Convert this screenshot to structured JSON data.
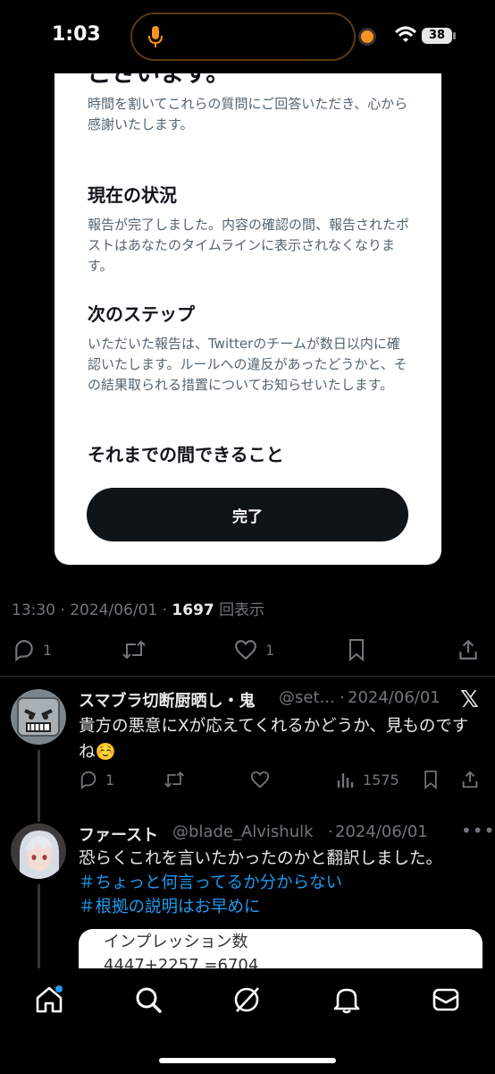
{
  "status": {
    "time": "1:03",
    "battery": "38"
  },
  "card": {
    "cut_heading": "ございます。",
    "intro": "時間を割いてこれらの質問にご回答いただき、心から感謝いたします。",
    "section1_title": "現在の状況",
    "section1_body": "報告が完了しました。内容の確認の間、報告されたポストはあなたのタイムラインに表示されなくなります。",
    "section2_title": "次のステップ",
    "section2_body": "いただいた報告は、Twitterのチームが数日以内に確認いたします。ルールへの違反があったどうかと、その結果取られる措置についてお知らせいたします。",
    "section3_title": "それまでの間できること",
    "done_label": "完了"
  },
  "post": {
    "time": "13:30",
    "date": "2024/06/01",
    "views": "1697",
    "views_label": "回表示",
    "replies": "1",
    "likes": "1"
  },
  "reply1": {
    "name": "スマブラ切断厨晒し・鬼",
    "handle": "@set...",
    "date": "2024/06/01",
    "text": "貴方の悪意にXが応えてくれるかどうか、見ものですね☺️",
    "replies": "1",
    "views": "1575"
  },
  "reply2": {
    "name": "ファースト",
    "handle": "@blade_Alvishulk",
    "date": "2024/06/01",
    "text": "恐らくこれを言いたかったのかと翻訳しました。",
    "hashtag1": "＃ちょっと何言ってるか分からない",
    "hashtag2": "＃根拠の説明はお早めに",
    "quote_line1": "インプレッション数",
    "quote_line2": "4447+2257 =6704"
  },
  "colors": {
    "accent": "#1d9bf0",
    "background": "#000000",
    "muted": "#71767b"
  }
}
